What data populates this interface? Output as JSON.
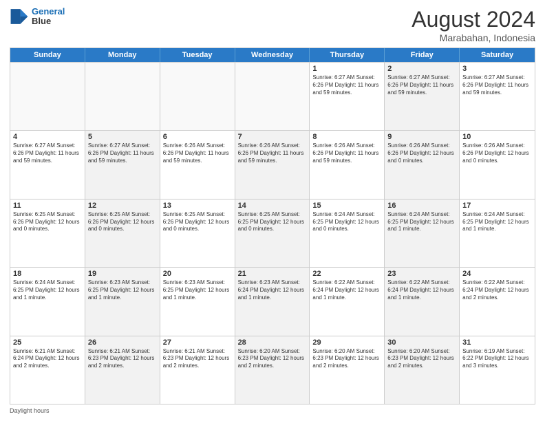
{
  "logo": {
    "line1": "General",
    "line2": "Blue"
  },
  "title": "August 2024",
  "subtitle": "Marabahan, Indonesia",
  "days_of_week": [
    "Sunday",
    "Monday",
    "Tuesday",
    "Wednesday",
    "Thursday",
    "Friday",
    "Saturday"
  ],
  "footer": "Daylight hours",
  "weeks": [
    [
      {
        "day": "",
        "info": "",
        "empty": true
      },
      {
        "day": "",
        "info": "",
        "empty": true
      },
      {
        "day": "",
        "info": "",
        "empty": true
      },
      {
        "day": "",
        "info": "",
        "empty": true
      },
      {
        "day": "1",
        "info": "Sunrise: 6:27 AM\nSunset: 6:26 PM\nDaylight: 11 hours\nand 59 minutes.",
        "empty": false
      },
      {
        "day": "2",
        "info": "Sunrise: 6:27 AM\nSunset: 6:26 PM\nDaylight: 11 hours\nand 59 minutes.",
        "empty": false,
        "shaded": true
      },
      {
        "day": "3",
        "info": "Sunrise: 6:27 AM\nSunset: 6:26 PM\nDaylight: 11 hours\nand 59 minutes.",
        "empty": false
      }
    ],
    [
      {
        "day": "4",
        "info": "Sunrise: 6:27 AM\nSunset: 6:26 PM\nDaylight: 11 hours\nand 59 minutes.",
        "empty": false
      },
      {
        "day": "5",
        "info": "Sunrise: 6:27 AM\nSunset: 6:26 PM\nDaylight: 11 hours\nand 59 minutes.",
        "empty": false,
        "shaded": true
      },
      {
        "day": "6",
        "info": "Sunrise: 6:26 AM\nSunset: 6:26 PM\nDaylight: 11 hours\nand 59 minutes.",
        "empty": false
      },
      {
        "day": "7",
        "info": "Sunrise: 6:26 AM\nSunset: 6:26 PM\nDaylight: 11 hours\nand 59 minutes.",
        "empty": false,
        "shaded": true
      },
      {
        "day": "8",
        "info": "Sunrise: 6:26 AM\nSunset: 6:26 PM\nDaylight: 11 hours\nand 59 minutes.",
        "empty": false
      },
      {
        "day": "9",
        "info": "Sunrise: 6:26 AM\nSunset: 6:26 PM\nDaylight: 12 hours\nand 0 minutes.",
        "empty": false,
        "shaded": true
      },
      {
        "day": "10",
        "info": "Sunrise: 6:26 AM\nSunset: 6:26 PM\nDaylight: 12 hours\nand 0 minutes.",
        "empty": false
      }
    ],
    [
      {
        "day": "11",
        "info": "Sunrise: 6:25 AM\nSunset: 6:26 PM\nDaylight: 12 hours\nand 0 minutes.",
        "empty": false
      },
      {
        "day": "12",
        "info": "Sunrise: 6:25 AM\nSunset: 6:26 PM\nDaylight: 12 hours\nand 0 minutes.",
        "empty": false,
        "shaded": true
      },
      {
        "day": "13",
        "info": "Sunrise: 6:25 AM\nSunset: 6:26 PM\nDaylight: 12 hours\nand 0 minutes.",
        "empty": false
      },
      {
        "day": "14",
        "info": "Sunrise: 6:25 AM\nSunset: 6:25 PM\nDaylight: 12 hours\nand 0 minutes.",
        "empty": false,
        "shaded": true
      },
      {
        "day": "15",
        "info": "Sunrise: 6:24 AM\nSunset: 6:25 PM\nDaylight: 12 hours\nand 0 minutes.",
        "empty": false
      },
      {
        "day": "16",
        "info": "Sunrise: 6:24 AM\nSunset: 6:25 PM\nDaylight: 12 hours\nand 1 minute.",
        "empty": false,
        "shaded": true
      },
      {
        "day": "17",
        "info": "Sunrise: 6:24 AM\nSunset: 6:25 PM\nDaylight: 12 hours\nand 1 minute.",
        "empty": false
      }
    ],
    [
      {
        "day": "18",
        "info": "Sunrise: 6:24 AM\nSunset: 6:25 PM\nDaylight: 12 hours\nand 1 minute.",
        "empty": false
      },
      {
        "day": "19",
        "info": "Sunrise: 6:23 AM\nSunset: 6:25 PM\nDaylight: 12 hours\nand 1 minute.",
        "empty": false,
        "shaded": true
      },
      {
        "day": "20",
        "info": "Sunrise: 6:23 AM\nSunset: 6:25 PM\nDaylight: 12 hours\nand 1 minute.",
        "empty": false
      },
      {
        "day": "21",
        "info": "Sunrise: 6:23 AM\nSunset: 6:24 PM\nDaylight: 12 hours\nand 1 minute.",
        "empty": false,
        "shaded": true
      },
      {
        "day": "22",
        "info": "Sunrise: 6:22 AM\nSunset: 6:24 PM\nDaylight: 12 hours\nand 1 minute.",
        "empty": false
      },
      {
        "day": "23",
        "info": "Sunrise: 6:22 AM\nSunset: 6:24 PM\nDaylight: 12 hours\nand 1 minute.",
        "empty": false,
        "shaded": true
      },
      {
        "day": "24",
        "info": "Sunrise: 6:22 AM\nSunset: 6:24 PM\nDaylight: 12 hours\nand 2 minutes.",
        "empty": false
      }
    ],
    [
      {
        "day": "25",
        "info": "Sunrise: 6:21 AM\nSunset: 6:24 PM\nDaylight: 12 hours\nand 2 minutes.",
        "empty": false
      },
      {
        "day": "26",
        "info": "Sunrise: 6:21 AM\nSunset: 6:23 PM\nDaylight: 12 hours\nand 2 minutes.",
        "empty": false,
        "shaded": true
      },
      {
        "day": "27",
        "info": "Sunrise: 6:21 AM\nSunset: 6:23 PM\nDaylight: 12 hours\nand 2 minutes.",
        "empty": false
      },
      {
        "day": "28",
        "info": "Sunrise: 6:20 AM\nSunset: 6:23 PM\nDaylight: 12 hours\nand 2 minutes.",
        "empty": false,
        "shaded": true
      },
      {
        "day": "29",
        "info": "Sunrise: 6:20 AM\nSunset: 6:23 PM\nDaylight: 12 hours\nand 2 minutes.",
        "empty": false
      },
      {
        "day": "30",
        "info": "Sunrise: 6:20 AM\nSunset: 6:23 PM\nDaylight: 12 hours\nand 2 minutes.",
        "empty": false,
        "shaded": true
      },
      {
        "day": "31",
        "info": "Sunrise: 6:19 AM\nSunset: 6:22 PM\nDaylight: 12 hours\nand 3 minutes.",
        "empty": false
      }
    ]
  ]
}
